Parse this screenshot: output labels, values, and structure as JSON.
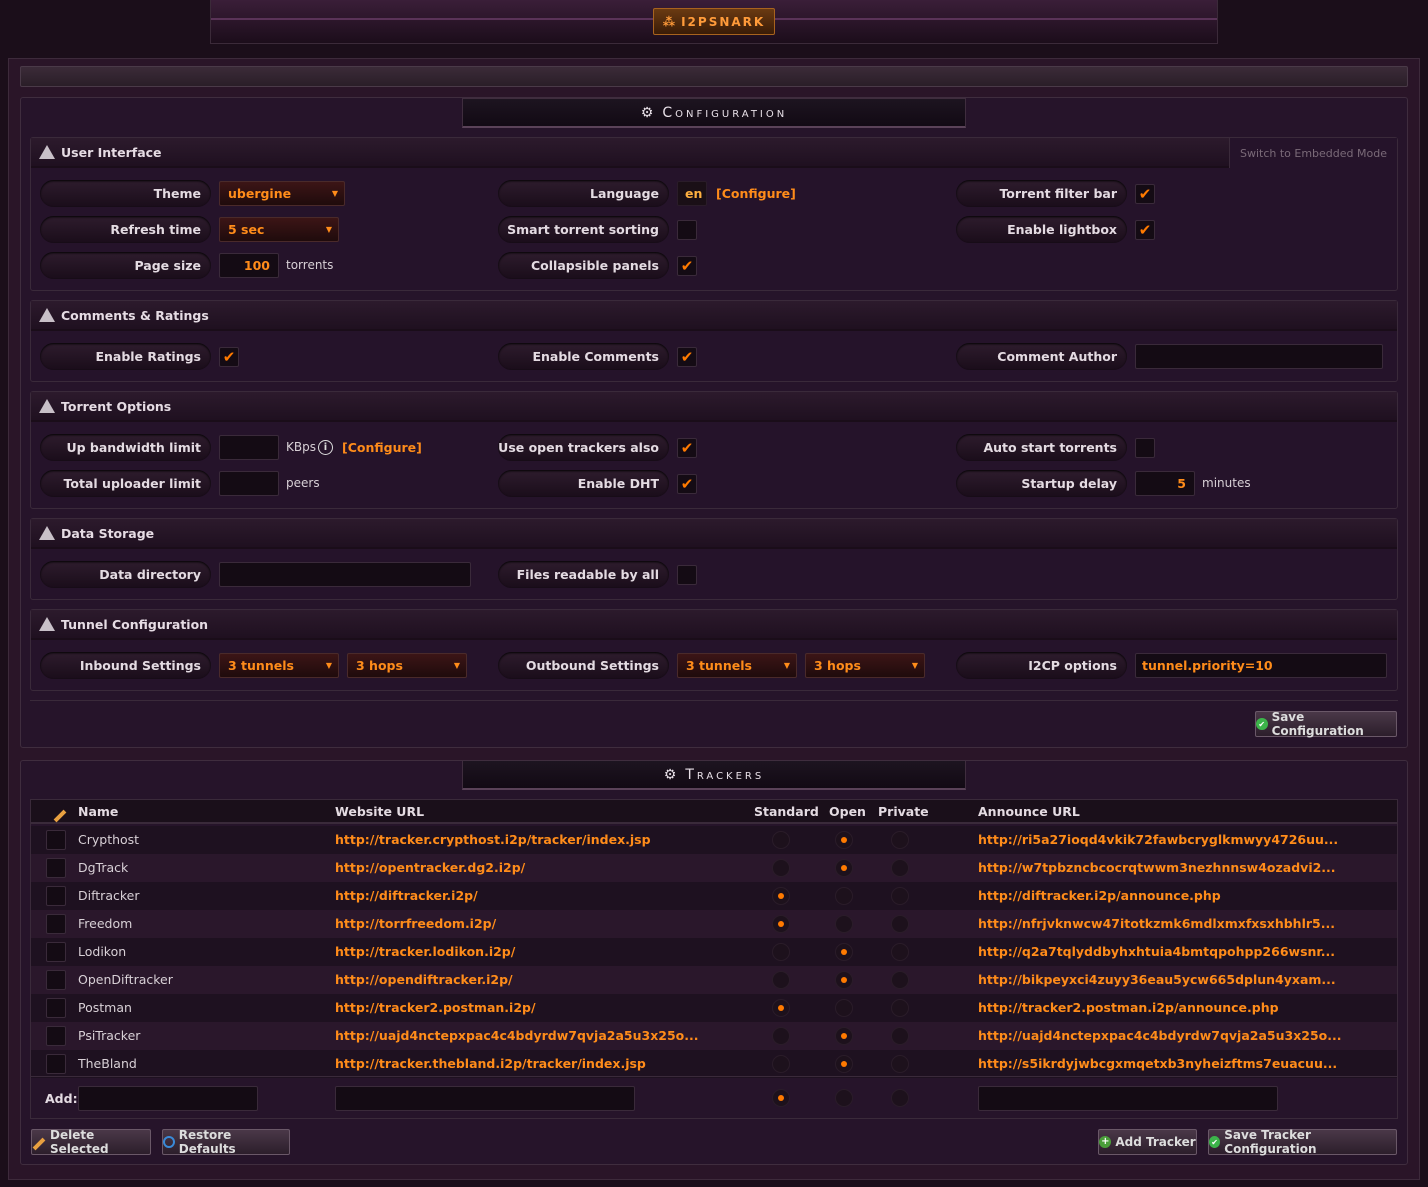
{
  "app": {
    "logo_text": "I2PSNARK"
  },
  "config": {
    "title": "Configuration",
    "save_label": "Save Configuration",
    "ui": {
      "title": "User Interface",
      "switch_mode": "Switch to Embedded Mode",
      "theme_label": "Theme",
      "theme_value": "ubergine",
      "refresh_label": "Refresh time",
      "refresh_value": "5 sec",
      "page_size_label": "Page size",
      "page_size_value": "100",
      "page_size_unit": "torrents",
      "language_label": "Language",
      "language_value": "en",
      "language_configure": "[Configure]",
      "smart_sort_label": "Smart torrent sorting",
      "smart_sort": false,
      "collapsible_label": "Collapsible panels",
      "collapsible": true,
      "filter_bar_label": "Torrent filter bar",
      "filter_bar": true,
      "lightbox_label": "Enable lightbox",
      "lightbox": true
    },
    "comments": {
      "title": "Comments & Ratings",
      "ratings_label": "Enable Ratings",
      "ratings": true,
      "comments_label": "Enable Comments",
      "comments": true,
      "author_label": "Comment Author",
      "author_value": ""
    },
    "torrent": {
      "title": "Torrent Options",
      "up_bw_label": "Up bandwidth limit",
      "up_bw_unit": "KBps",
      "up_bw_configure": "[Configure]",
      "uploader_label": "Total uploader limit",
      "uploader_unit": "peers",
      "open_trackers_label": "Use open trackers also",
      "open_trackers": true,
      "dht_label": "Enable DHT",
      "dht": true,
      "autostart_label": "Auto start torrents",
      "autostart": false,
      "startup_delay_label": "Startup delay",
      "startup_delay_value": "5",
      "startup_delay_unit": "minutes"
    },
    "storage": {
      "title": "Data Storage",
      "dir_label": "Data directory",
      "dir_value": "",
      "readable_label": "Files readable by all",
      "readable": false
    },
    "tunnel": {
      "title": "Tunnel Configuration",
      "inbound_label": "Inbound Settings",
      "inbound_tunnels": "3 tunnels",
      "inbound_hops": "3 hops",
      "outbound_label": "Outbound Settings",
      "outbound_tunnels": "3 tunnels",
      "outbound_hops": "3 hops",
      "i2cp_label": "I2CP options",
      "i2cp_value": "tunnel.priority=10"
    }
  },
  "trackers": {
    "title": "Trackers",
    "columns": {
      "name": "Name",
      "website": "Website URL",
      "standard": "Standard",
      "open": "Open",
      "private": "Private",
      "announce": "Announce URL"
    },
    "rows": [
      {
        "name": "Crypthost",
        "website": "http://tracker.crypthost.i2p/tracker/index.jsp",
        "type": "open",
        "announce": "http://ri5a27ioqd4vkik72fawbcryglkmwyy4726uu..."
      },
      {
        "name": "DgTrack",
        "website": "http://opentracker.dg2.i2p/",
        "type": "open",
        "announce": "http://w7tpbzncbcocrqtwwm3nezhnnsw4ozadvi2..."
      },
      {
        "name": "Diftracker",
        "website": "http://diftracker.i2p/",
        "type": "standard",
        "announce": "http://diftracker.i2p/announce.php"
      },
      {
        "name": "Freedom",
        "website": "http://torrfreedom.i2p/",
        "type": "standard",
        "announce": "http://nfrjvknwcw47itotkzmk6mdlxmxfxsxhbhlr5..."
      },
      {
        "name": "Lodikon",
        "website": "http://tracker.lodikon.i2p/",
        "type": "open",
        "announce": "http://q2a7tqlyddbyhxhtuia4bmtqpohpp266wsnr..."
      },
      {
        "name": "OpenDiftracker",
        "website": "http://opendiftracker.i2p/",
        "type": "open",
        "announce": "http://bikpeyxci4zuyy36eau5ycw665dplun4yxam..."
      },
      {
        "name": "Postman",
        "website": "http://tracker2.postman.i2p/",
        "type": "standard",
        "announce": "http://tracker2.postman.i2p/announce.php"
      },
      {
        "name": "PsiTracker",
        "website": "http://uajd4nctepxpac4c4bdyrdw7qvja2a5u3x25o...",
        "type": "open",
        "announce": "http://uajd4nctepxpac4c4bdyrdw7qvja2a5u3x25o..."
      },
      {
        "name": "TheBland",
        "website": "http://tracker.thebland.i2p/tracker/index.jsp",
        "type": "open",
        "announce": "http://s5ikrdyjwbcgxmqetxb3nyheizftms7euacuu..."
      }
    ],
    "add_label": "Add:",
    "add_type": "standard",
    "delete_label": "Delete Selected",
    "restore_label": "Restore Defaults",
    "add_tracker_label": "Add Tracker",
    "save_label": "Save Tracker Configuration"
  }
}
